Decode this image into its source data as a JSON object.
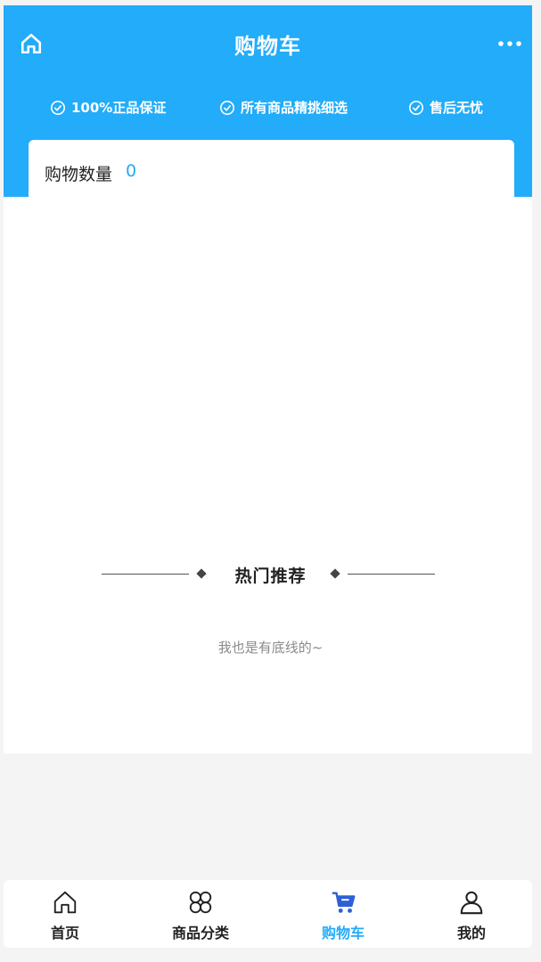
{
  "header": {
    "title": "购物车",
    "guarantees": [
      {
        "label": "100%正品保证"
      },
      {
        "label": "所有商品精挑细选"
      },
      {
        "label": "售后无忧"
      }
    ]
  },
  "cart": {
    "count_label": "购物数量",
    "count_value": "0"
  },
  "recommend": {
    "title": "热门推荐",
    "bottom_text": "我也是有底线的~"
  },
  "tabbar": {
    "items": [
      {
        "label": "首页",
        "icon": "home-icon"
      },
      {
        "label": "商品分类",
        "icon": "category-icon"
      },
      {
        "label": "购物车",
        "icon": "cart-icon",
        "active": true
      },
      {
        "label": "我的",
        "icon": "user-icon"
      }
    ]
  },
  "colors": {
    "primary": "#22acf9",
    "cart_active": "#2f5fd6",
    "background": "#f4f4f4"
  }
}
